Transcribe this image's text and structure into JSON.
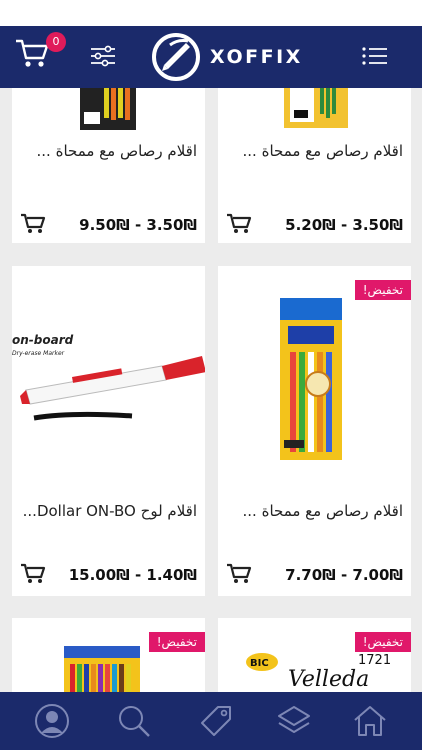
{
  "header": {
    "cart_count": "0",
    "logo_text": "XOFFIX"
  },
  "products": [
    {
      "name": "اقلام رصاص مع ممحاة ...",
      "price_low": "3.50₪",
      "price_high": "5.20₪",
      "sale_badge": ""
    },
    {
      "name": "اقلام رصاص مع ممحاة ...",
      "price_low": "3.50₪",
      "price_high": "9.50₪",
      "sale_badge": ""
    },
    {
      "name": "اقلام رصاص مع ممحاة ...",
      "price_low": "7.00₪",
      "price_high": "7.70₪",
      "sale_badge": "تخفيض!"
    },
    {
      "name": "اقلام لوح Dollar ON-BO...",
      "price_low": "1.40₪",
      "price_high": "15.00₪",
      "sale_badge": ""
    },
    {
      "name": "",
      "price_low": "",
      "price_high": "",
      "sale_badge": "تخفيض!"
    },
    {
      "name": "",
      "price_low": "",
      "price_high": "",
      "sale_badge": "تخفيض!"
    }
  ],
  "price_separator": "-",
  "colors": {
    "header": "#1b2a6b",
    "badge": "#e01b5a",
    "sale": "#e0186a"
  },
  "icons": {
    "cart": "cart-icon",
    "filter": "filter-icon",
    "menu": "menu-icon",
    "bottom_nav": [
      "profile-icon",
      "search-icon",
      "tag-icon",
      "layers-icon",
      "home-icon"
    ]
  }
}
